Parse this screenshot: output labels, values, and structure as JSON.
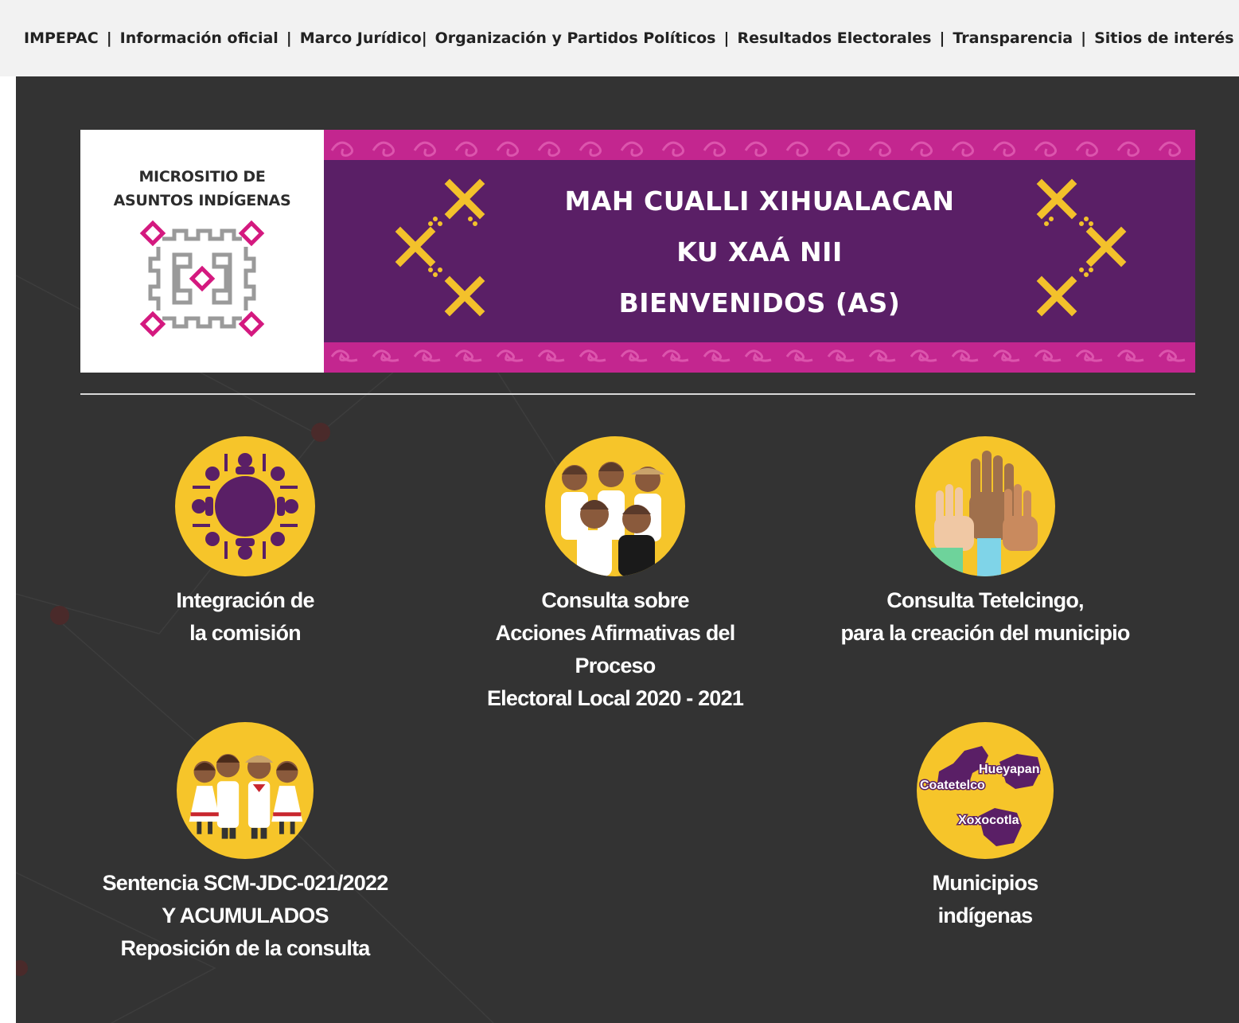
{
  "nav": {
    "items": [
      {
        "label": "IMPEPAC"
      },
      {
        "label": "Información oficial"
      },
      {
        "label": "Marco Jurídico"
      },
      {
        "label": "Organización y Partidos Políticos"
      },
      {
        "label": "Resultados Electorales"
      },
      {
        "label": "Transparencia"
      },
      {
        "label": "Sitios de interés"
      }
    ],
    "separator": "|"
  },
  "banner": {
    "logo_line1": "MICROSITIO DE",
    "logo_line2": "ASUNTOS INDÍGENAS",
    "greeting_1": "MAH CUALLI XIHUALACAN",
    "greeting_2": "KU XAÁ NII",
    "greeting_3": "BIENVENIDOS (AS)"
  },
  "cards": {
    "integracion": {
      "label": "Integración de\nla comisión",
      "icon": "round-table-icon"
    },
    "consulta_acciones": {
      "label": "Consulta sobre\nAcciones Afirmativas del Proceso\nElectoral Local 2020 - 2021",
      "icon": "children-group-icon"
    },
    "consulta_tetelcingo": {
      "label": "Consulta Tetelcingo,\npara la creación del municipio",
      "icon": "raised-hands-icon"
    },
    "sentencia": {
      "label": "Sentencia SCM-JDC-021/2022\nY ACUMULADOS\nReposición de la consulta",
      "icon": "people-row-icon"
    },
    "municipios": {
      "label": "Municipios\nindígenas",
      "icon": "map-icon",
      "map_labels": [
        "Hueyapan",
        "Coatetelco",
        "Xoxocotla"
      ]
    }
  },
  "colors": {
    "nav_bg": "#f2f2f2",
    "page_bg": "#333333",
    "banner_purple": "#5a1f66",
    "banner_pink": "#c3268f",
    "circle_yellow": "#f6c52a",
    "motif_yellow": "#f3c12b"
  }
}
